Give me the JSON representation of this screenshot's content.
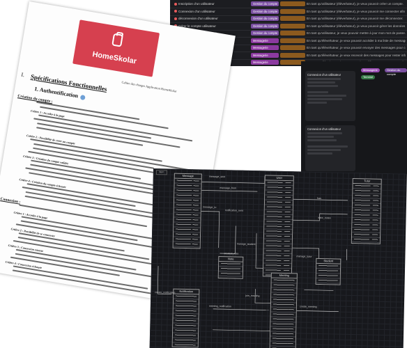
{
  "table": {
    "rows": [
      {
        "title": "Inscription d'un utilisateur",
        "tag1": "Gestion du compte",
        "tag2": "",
        "desc": "En tant qu'utilisateur (élève/tuteur), je veux pouvoir créer un compte."
      },
      {
        "title": "Connexion d'un utilisateur",
        "tag1": "Gestion du compte",
        "tag2": "",
        "desc": "En tant qu'utilisateur (élève/tuteur), je veux pouvoir me connecter afin d'accéder au site."
      },
      {
        "title": "déconnexion d'un utilisateur",
        "tag1": "Gestion du compte",
        "tag2": "",
        "desc": "En tant qu'utilisateur (élève/tuteur), je veux pouvoir me déconnecter."
      },
      {
        "title": "Gérer le compte utilisateur",
        "tag1": "Gestion du compte",
        "tag2": "",
        "desc": "En tant qu'utilisateur (élève/tuteur), je veux pouvoir gérer les données de mon profil."
      },
      {
        "title": "Changement mot de passe",
        "tag1": "Gestion du compte",
        "tag2": "",
        "desc": "En tant qu'utilisateur, je veux pouvoir mettre à jour mon mot de passe."
      },
      {
        "title": "Voir first message",
        "tag1": "Messagerie",
        "tag2": "",
        "desc": "En tant qu'élève/tuteur, je veux pouvoir accéder à ma liste de message."
      },
      {
        "title": "Envoyer un message",
        "tag1": "Messagerie",
        "tag2": "",
        "desc": "En tant qu'élève/tuteur, je veux pouvoir envoyer des messages pour communiquer."
      },
      {
        "title": "Recevoir des messages",
        "tag1": "Messagerie",
        "tag2": "",
        "desc": "En tant qu'élève/tuteur, je veux recevoir des messages pour rester informé."
      },
      {
        "title": "Modifier message",
        "tag1": "Messagerie",
        "tag2": "",
        "desc": "En tant qu'élève/tuteur, je veux pouvoir modifier un message envoyé pour corriger."
      }
    ],
    "colors": {
      "account": "#7a4fa0",
      "messages": "#8c3aa0",
      "bullet": "#e85c5c"
    }
  },
  "kanban": {
    "cards": [
      {
        "title": "Connexion d'un utilisateur"
      },
      {
        "title": "Connexion d'un utilisateur"
      }
    ],
    "pills": [
      {
        "label": "Messagerie",
        "color": "#9b4fb5"
      },
      {
        "label": "Terminé",
        "color": "#3a7d4a"
      },
      {
        "label": "Gestion du compte",
        "color": "#7a4fa0"
      }
    ]
  },
  "document": {
    "logo_text": "HomeSkolar",
    "subtitle": "Cahier des charges Application HomeSkolar",
    "section_number": "I.",
    "section_title": "Spécifications Fonctionnelles",
    "subsection_title": "1. Authentification",
    "sub_headings": [
      "Création du compte :",
      "Connexion :"
    ],
    "criteria": [
      "Critère 1 : Accéder à la page",
      "Critère 2 : Possibilité de créer un compte",
      "Critère 3 : Création du compte validée",
      "Critère 4 : Création du compte échouée",
      "Critère 1 : Accéder à la page",
      "Critère 2 : Possibilité de se connecter",
      "Critère 3 : Connexion réussie",
      "Critère 4 : Connexion échouée"
    ]
  },
  "diagram": {
    "tab_label": "Item",
    "entities": [
      "Message",
      "User",
      "Tutor",
      "Note",
      "Student",
      "Meeting",
      "Notification"
    ],
    "relations": [
      "message_sent",
      "message_from",
      "message_to",
      "notification_sent",
      "has",
      "tutor_notes",
      "manage_student",
      "created_note",
      "manage_tutor",
      "join_meeting",
      "meeting_notification",
      "create_meeting",
      "create_notification"
    ]
  }
}
